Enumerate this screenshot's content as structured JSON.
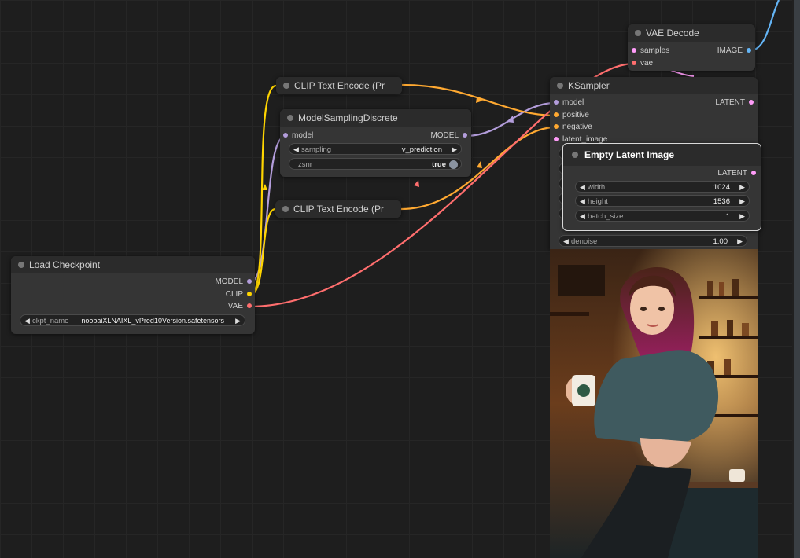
{
  "nodes": {
    "vae_decode": {
      "title": "VAE Decode",
      "inputs": [
        "samples",
        "vae"
      ],
      "output": "IMAGE"
    },
    "clip_text_encode_top": {
      "title": "CLIP Text Encode (Pr"
    },
    "clip_text_encode_bottom": {
      "title": "CLIP Text Encode (Pr"
    },
    "model_sampling": {
      "title": "ModelSamplingDiscrete",
      "input": "model",
      "output": "MODEL",
      "sampling_label": "sampling",
      "sampling_value": "v_prediction",
      "zsnr_label": "zsnr",
      "zsnr_value": "true"
    },
    "ksampler": {
      "title": "KSampler",
      "inputs": [
        "model",
        "positive",
        "negative",
        "latent_image"
      ],
      "output": "LATENT",
      "denoise_label": "denoise",
      "denoise_value": "1.00"
    },
    "empty_latent": {
      "title": "Empty Latent Image",
      "output": "LATENT",
      "width_label": "width",
      "width_value": "1024",
      "height_label": "height",
      "height_value": "1536",
      "batch_label": "batch_size",
      "batch_value": "1"
    },
    "load_checkpoint": {
      "title": "Load Checkpoint",
      "outputs": [
        "MODEL",
        "CLIP",
        "VAE"
      ],
      "ckpt_label": "ckpt_name",
      "ckpt_value": "noobaiXLNAIXL_vPred10Version.safetensors"
    }
  },
  "colors": {
    "model": "#b39ddb",
    "clip": "#ffd500",
    "vae": "#ff6e6e",
    "conditioning": "#ffa931",
    "latent": "#ff9cf9",
    "image": "#64b5f6"
  },
  "icons": {
    "arrow_left": "◀",
    "arrow_right": "▶"
  }
}
